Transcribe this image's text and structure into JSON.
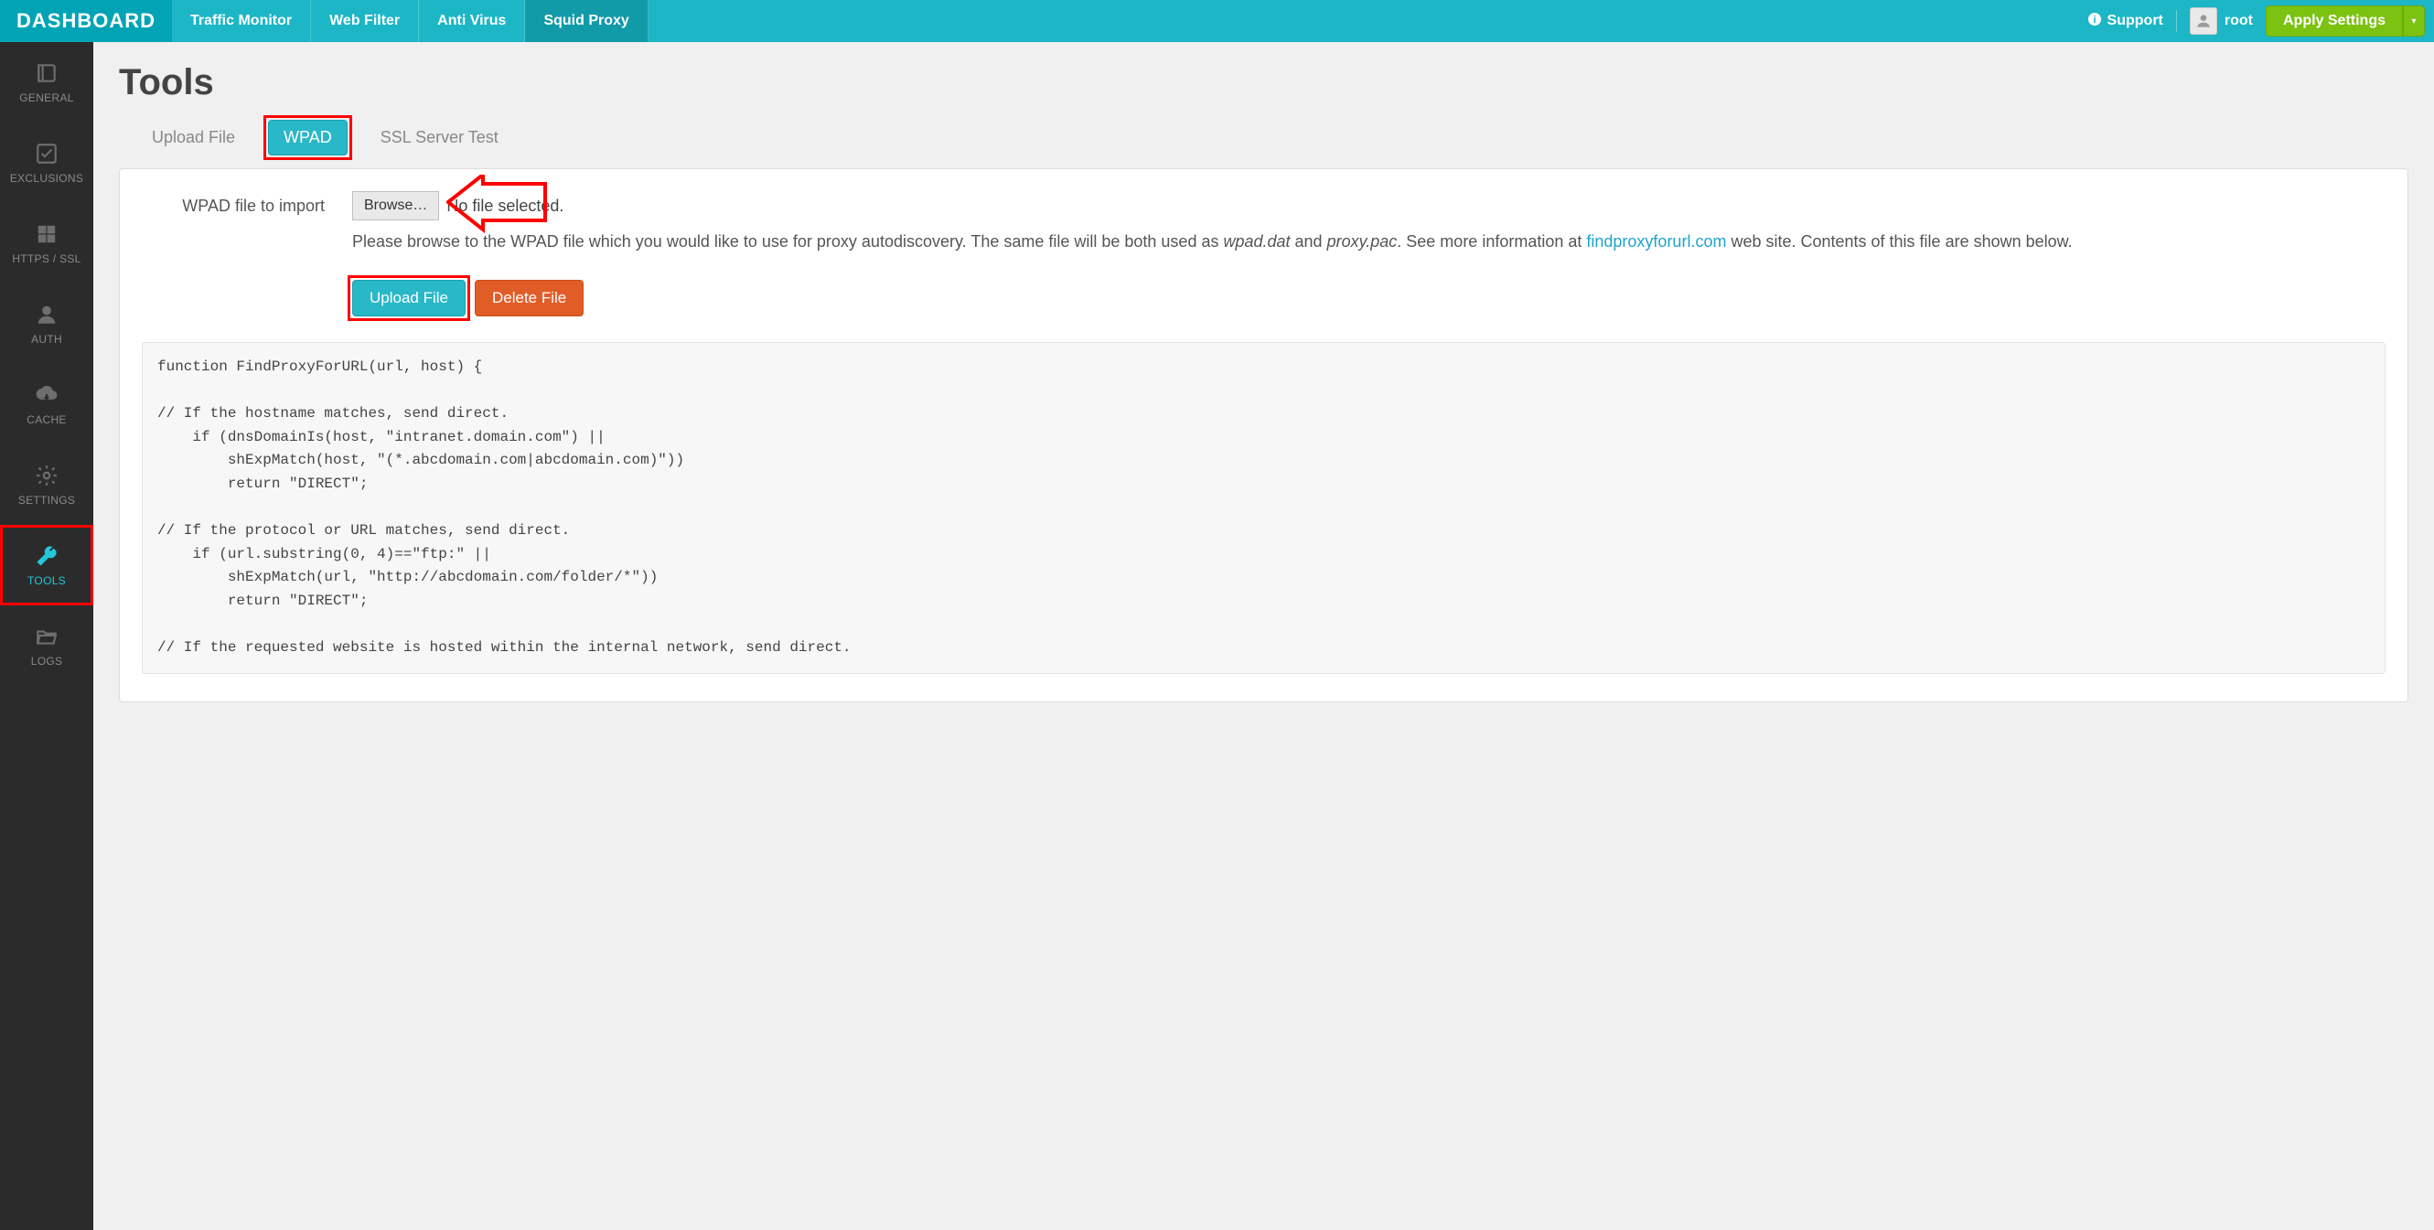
{
  "header": {
    "brand": "DASHBOARD",
    "nav": [
      {
        "label": "Traffic Monitor",
        "active": false
      },
      {
        "label": "Web Filter",
        "active": false
      },
      {
        "label": "Anti Virus",
        "active": false
      },
      {
        "label": "Squid Proxy",
        "active": true
      }
    ],
    "support_label": "Support",
    "username": "root",
    "apply_label": "Apply Settings"
  },
  "sidebar": {
    "items": [
      {
        "label": "GENERAL",
        "icon": "book-icon",
        "active": false
      },
      {
        "label": "EXCLUSIONS",
        "icon": "check-square-icon",
        "active": false
      },
      {
        "label": "HTTPS / SSL",
        "icon": "grid-icon",
        "active": false
      },
      {
        "label": "AUTH",
        "icon": "user-icon",
        "active": false
      },
      {
        "label": "CACHE",
        "icon": "cloud-download-icon",
        "active": false
      },
      {
        "label": "SETTINGS",
        "icon": "gear-icon",
        "active": false
      },
      {
        "label": "TOOLS",
        "icon": "wrench-icon",
        "active": true
      },
      {
        "label": "LOGS",
        "icon": "folder-open-icon",
        "active": false
      }
    ]
  },
  "page": {
    "title": "Tools",
    "tabs": [
      {
        "label": "Upload File",
        "active": false
      },
      {
        "label": "WPAD",
        "active": true
      },
      {
        "label": "SSL Server Test",
        "active": false
      }
    ],
    "form": {
      "label": "WPAD file to import",
      "browse_label": "Browse…",
      "file_status": "No file selected.",
      "help_pre": "Please browse to the WPAD file which you would like to use for proxy autodiscovery. The same file will be both used as ",
      "help_em1": "wpad.dat",
      "help_mid1": " and ",
      "help_em2": "proxy.pac",
      "help_mid2": ". See more information at ",
      "help_link_text": "findproxyforurl.com",
      "help_post": " web site. Contents of this file are shown below.",
      "upload_btn": "Upload File",
      "delete_btn": "Delete File"
    },
    "code": "function FindProxyForURL(url, host) {\n\n// If the hostname matches, send direct.\n    if (dnsDomainIs(host, \"intranet.domain.com\") ||\n        shExpMatch(host, \"(*.abcdomain.com|abcdomain.com)\"))\n        return \"DIRECT\";\n\n// If the protocol or URL matches, send direct.\n    if (url.substring(0, 4)==\"ftp:\" ||\n        shExpMatch(url, \"http://abcdomain.com/folder/*\"))\n        return \"DIRECT\";\n\n// If the requested website is hosted within the internal network, send direct."
  }
}
